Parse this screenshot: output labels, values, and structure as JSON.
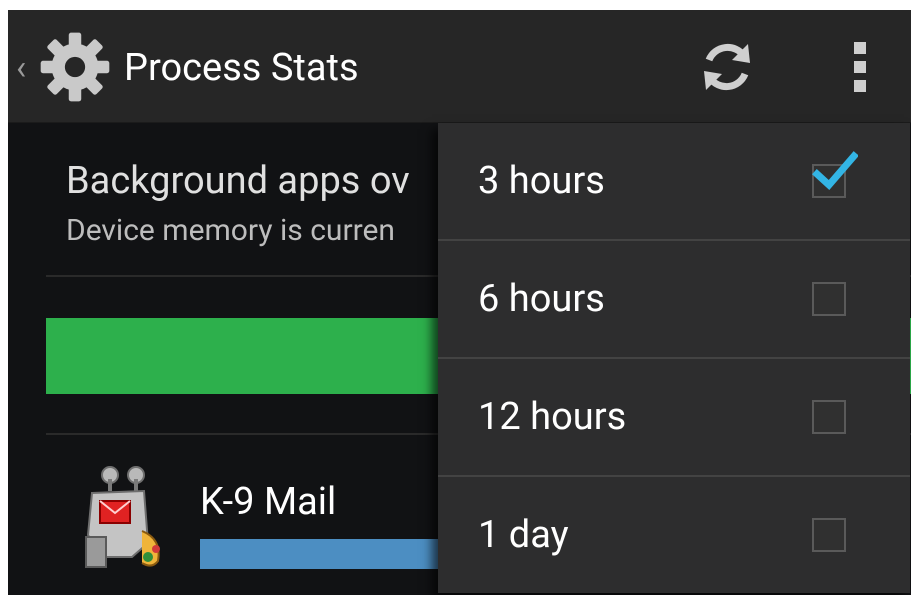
{
  "action_bar": {
    "title": "Process Stats",
    "icons": {
      "up": "chevron-left-icon",
      "app": "gear-icon",
      "refresh": "refresh-icon",
      "overflow": "overflow-menu-icon"
    },
    "up_glyph": "‹"
  },
  "summary": {
    "title": "Background apps ov",
    "subtitle": "Device memory is curren"
  },
  "memory_bar": {
    "color": "#2db04c"
  },
  "apps": [
    {
      "name": "K-9 Mail",
      "icon": "k9-mail-robot-icon",
      "usage_bar_color": "#4c8ec2"
    }
  ],
  "duration_menu": {
    "items": [
      {
        "label": "3 hours",
        "checked": true
      },
      {
        "label": "6 hours",
        "checked": false
      },
      {
        "label": "12 hours",
        "checked": false
      },
      {
        "label": "1 day",
        "checked": false
      }
    ],
    "check_color": "#33b5e5"
  }
}
